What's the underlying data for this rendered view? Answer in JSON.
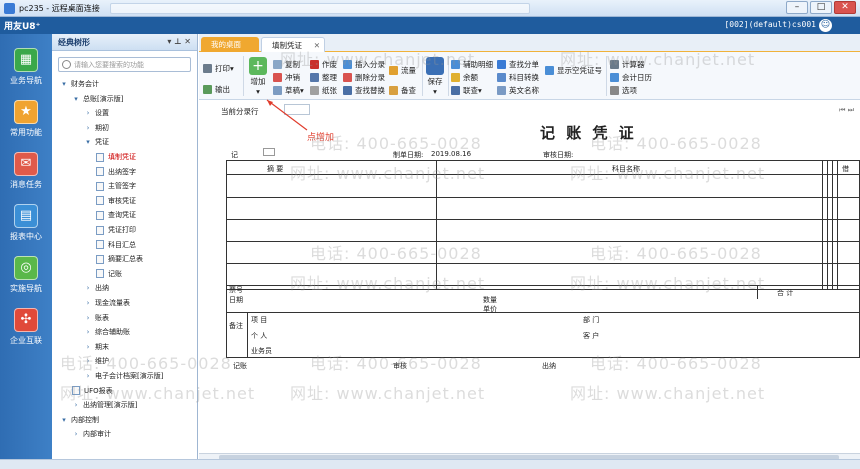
{
  "window": {
    "title": "pc235 - 远程桌面连接"
  },
  "app": {
    "logo": "用友U8⁺",
    "env": "[002](default)cs001",
    "user_icon": "user-icon"
  },
  "leftnav": [
    {
      "label": "业务导航",
      "icon": "grid-icon",
      "color": "#3aa84a"
    },
    {
      "label": "常用功能",
      "icon": "star-icon",
      "color": "#f0a330"
    },
    {
      "label": "消息任务",
      "icon": "envelope-icon",
      "color": "#e05a4a"
    },
    {
      "label": "报表中心",
      "icon": "report-icon",
      "color": "#3b8fd6"
    },
    {
      "label": "实施导航",
      "icon": "compass-icon",
      "color": "#5ab84a"
    },
    {
      "label": "企业互联",
      "icon": "connect-icon",
      "color": "#e04a3a"
    }
  ],
  "tree": {
    "title": "经典树形",
    "search_placeholder": "请输入您要搜索的功能",
    "nodes": [
      {
        "label": "财务会计",
        "level": 0,
        "arrow": "▾"
      },
      {
        "label": "总账[演示版]",
        "level": 1,
        "arrow": "▾"
      },
      {
        "label": "设置",
        "level": 2,
        "arrow": "›"
      },
      {
        "label": "期初",
        "level": 2,
        "arrow": "›"
      },
      {
        "label": "凭证",
        "level": 2,
        "arrow": "▾"
      },
      {
        "label": "填制凭证",
        "level": 3,
        "doc": true,
        "selected": true
      },
      {
        "label": "出纳签字",
        "level": 3,
        "doc": true
      },
      {
        "label": "主管签字",
        "level": 3,
        "doc": true
      },
      {
        "label": "审核凭证",
        "level": 3,
        "doc": true
      },
      {
        "label": "查询凭证",
        "level": 3,
        "doc": true
      },
      {
        "label": "凭证打印",
        "level": 3,
        "doc": true
      },
      {
        "label": "科目汇总",
        "level": 3,
        "doc": true
      },
      {
        "label": "摘要汇总表",
        "level": 3,
        "doc": true
      },
      {
        "label": "记账",
        "level": 3,
        "doc": true
      },
      {
        "label": "出纳",
        "level": 2,
        "arrow": "›"
      },
      {
        "label": "现金流量表",
        "level": 2,
        "arrow": "›"
      },
      {
        "label": "账表",
        "level": 2,
        "arrow": "›"
      },
      {
        "label": "综合辅助账",
        "level": 2,
        "arrow": "›"
      },
      {
        "label": "期末",
        "level": 2,
        "arrow": "›"
      },
      {
        "label": "维护",
        "level": 2,
        "arrow": "›"
      },
      {
        "label": "电子会计档案[演示版]",
        "level": 2,
        "arrow": "›"
      },
      {
        "label": "UFO报表",
        "level": 1,
        "doc": true
      },
      {
        "label": "出纳管理[演示版]",
        "level": 1,
        "arrow": "›"
      },
      {
        "label": "内部控制",
        "level": 0,
        "arrow": "▾"
      },
      {
        "label": "内部审计",
        "level": 1,
        "arrow": "›"
      }
    ]
  },
  "tabs": [
    {
      "label": "我的桌面"
    },
    {
      "label": "填制凭证"
    }
  ],
  "ribbon": {
    "print": "打印",
    "output": "输出",
    "add": "增加",
    "copy": "复制",
    "offset": "冲销",
    "draft": "草稿",
    "void": "作废",
    "tidy": "整理",
    "clear": "纸张",
    "insert_entry": "插入分录",
    "delete_entry": "删除分录",
    "lookup_offset": "查找替换",
    "flow": "流量",
    "reserve": "备查",
    "save": "保存",
    "aux_detail": "辅助明细",
    "balance": "余额",
    "link": "联查",
    "find_entry": "查找分单",
    "subject_conv": "科目转换",
    "en_name": "英文名称",
    "show_blank": "显示空凭证号",
    "calculator": "计算器",
    "acct_calendar": "会计日历",
    "options": "选项"
  },
  "voucher": {
    "current_entry_label": "当前分录行",
    "annotation": "点增加",
    "title": "记 账 凭 证",
    "type_label": "记",
    "date_label": "制单日期:",
    "date_value": "2019.08.16",
    "audit_label": "审核日期:",
    "col_summary": "摘  要",
    "col_subject": "科目名称",
    "col_debit": "借",
    "ticket_no": "票号",
    "date": "日期",
    "quantity": "数量",
    "unit_price": "单价",
    "total": "合 计",
    "remarks": "备注",
    "project": "项  目",
    "individual": "个  人",
    "salesman": "业务员",
    "dept": "部  门",
    "customer": "客  户",
    "bookkeeper": "记账",
    "auditor": "审核",
    "cashier": "出纳"
  },
  "watermarks": {
    "phone": "电话: 400-665-0028",
    "site": "网址: www.chanjet.net"
  }
}
